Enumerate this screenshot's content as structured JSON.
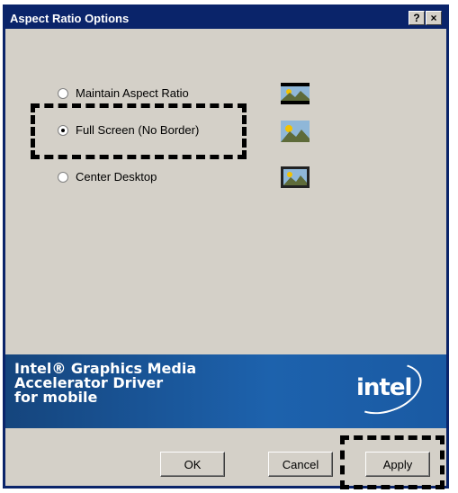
{
  "dialog": {
    "title": "Aspect Ratio Options",
    "help_button": "?",
    "close_button": "×"
  },
  "options": [
    {
      "label": "Maintain Aspect Ratio",
      "checked": false,
      "thumbnail": "maintain-aspect-thumbnail-icon"
    },
    {
      "label": "Full Screen (No Border)",
      "checked": true,
      "thumbnail": "full-screen-thumbnail-icon"
    },
    {
      "label": "Center Desktop",
      "checked": false,
      "thumbnail": "center-desktop-thumbnail-icon"
    }
  ],
  "banner": {
    "line1": "Intel® Graphics Media",
    "line2": "Accelerator Driver",
    "line3": "for mobile",
    "logo_text": "intel"
  },
  "buttons": {
    "ok": "OK",
    "cancel": "Cancel",
    "apply": "Apply"
  },
  "colors": {
    "titlebar": "#0a246a",
    "dialog_bg": "#d4d0c8",
    "banner": "#1d62ad"
  }
}
